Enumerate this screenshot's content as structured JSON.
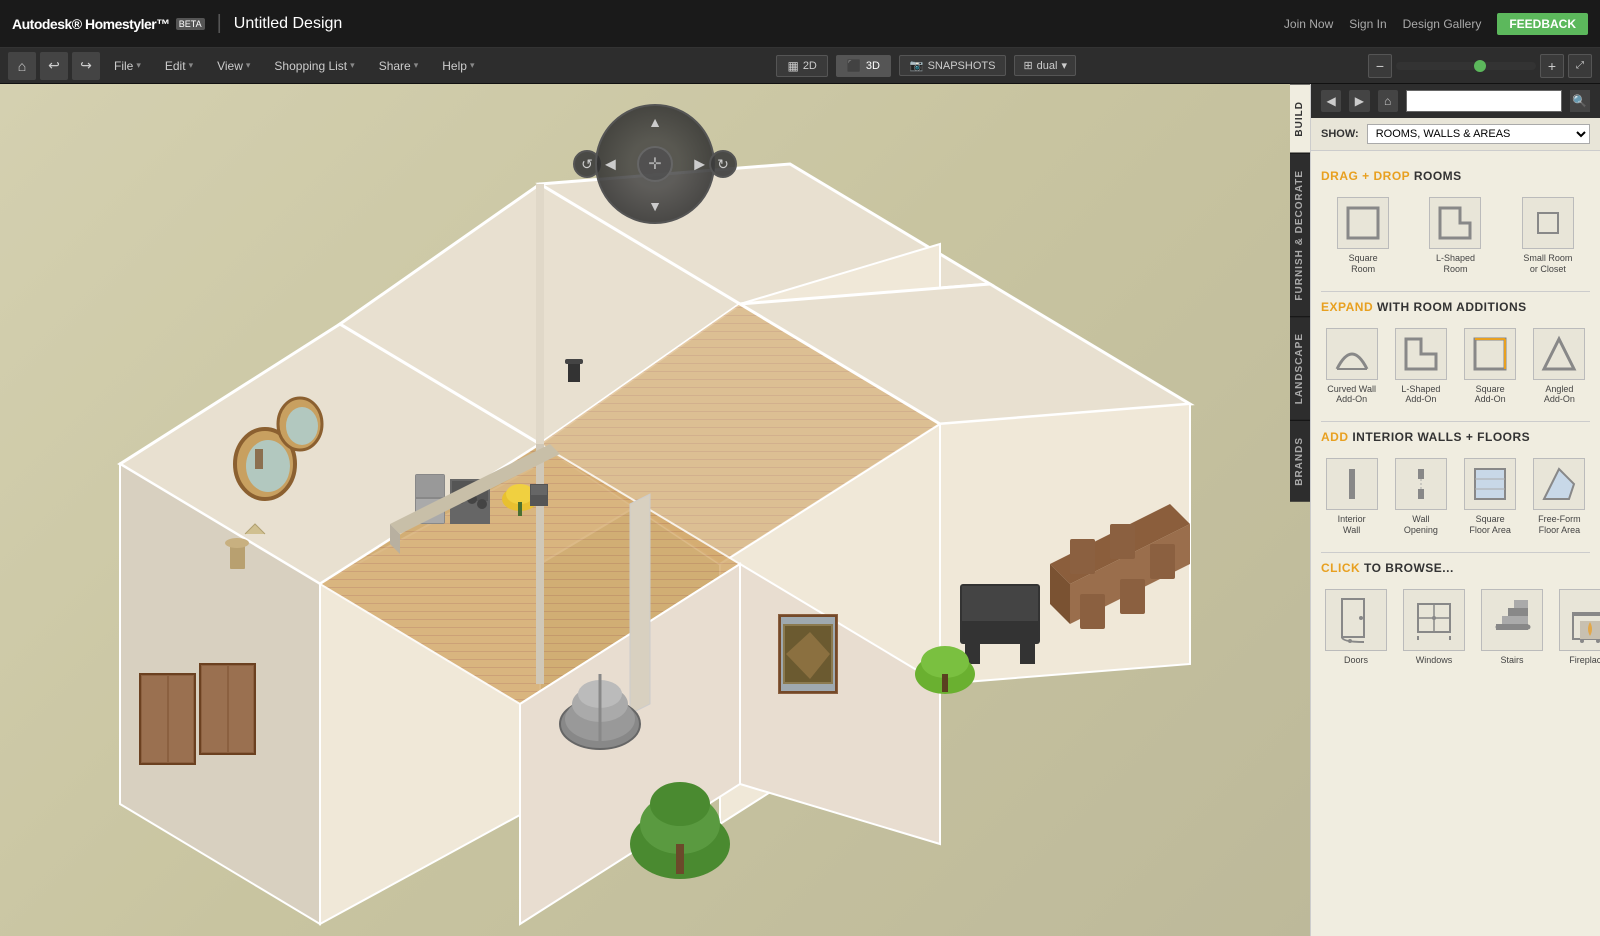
{
  "topBar": {
    "brand": "Autodesk® Homestyler™",
    "beta": "BETA",
    "titleSeparator": "|",
    "designTitle": "Untitled Design",
    "links": [
      "Join Now",
      "Sign In",
      "Design Gallery"
    ],
    "feedbackBtn": "FEEDBACK"
  },
  "menuBar": {
    "undoIcon": "↩",
    "redoIcon": "↪",
    "homeIcon": "⌂",
    "menus": [
      {
        "label": "File",
        "arrow": "▾"
      },
      {
        "label": "Edit",
        "arrow": "▾"
      },
      {
        "label": "View",
        "arrow": "▾"
      },
      {
        "label": "Shopping List",
        "arrow": "▾"
      },
      {
        "label": "Share",
        "arrow": "▾"
      },
      {
        "label": "Help",
        "arrow": "▾"
      }
    ],
    "view2D": "2D",
    "view3D": "3D",
    "snapshots": "SNAPSHOTS",
    "dual": "dual",
    "dualArrow": "▾",
    "zoomInIcon": "🔍",
    "zoomOutIcon": "🔍",
    "fullscreenIcon": "⤢"
  },
  "sideTabs": [
    {
      "label": "BUILD",
      "active": true
    },
    {
      "label": "FURNISH & DECORATE",
      "active": false
    },
    {
      "label": "LANDSCAPE",
      "active": false
    },
    {
      "label": "BRANDS",
      "active": false
    }
  ],
  "panel": {
    "backIcon": "◀",
    "forwardIcon": "▶",
    "homeIcon": "⌂",
    "searchPlaceholder": "",
    "searchIcon": "🔍",
    "showLabel": "SHOW:",
    "showOptions": [
      "ROOMS, WALLS & AREAS"
    ],
    "showSelected": "ROOMS, WALLS & AREAS",
    "sections": [
      {
        "id": "drag-rooms",
        "keyword": "DRAG + DROP",
        "rest": " ROOMS",
        "items": [
          {
            "label": "Square\nRoom",
            "iconType": "square-room"
          },
          {
            "label": "L-Shaped\nRoom",
            "iconType": "l-room"
          },
          {
            "label": "Small Room\nor Closet",
            "iconType": "small-room"
          }
        ],
        "cols": 3
      },
      {
        "id": "expand-additions",
        "keyword": "EXPAND",
        "rest": " WITH ROOM ADDITIONS",
        "items": [
          {
            "label": "Curved Wall\nAdd-On",
            "iconType": "curved-wall"
          },
          {
            "label": "L-Shaped\nAdd-On",
            "iconType": "l-addon"
          },
          {
            "label": "Square\nAdd-On",
            "iconType": "square-addon"
          },
          {
            "label": "Angled\nAdd-On",
            "iconType": "angled-addon"
          }
        ],
        "cols": 4
      },
      {
        "id": "interior-walls",
        "keyword": "ADD",
        "rest": " INTERIOR WALLS + FLOORS",
        "items": [
          {
            "label": "Interior\nWall",
            "iconType": "interior-wall"
          },
          {
            "label": "Wall\nOpening",
            "iconType": "wall-opening"
          },
          {
            "label": "Square\nFloor Area",
            "iconType": "square-floor"
          },
          {
            "label": "Free-Form\nFloor Area",
            "iconType": "freeform-floor"
          }
        ],
        "cols": 4
      },
      {
        "id": "click-browse",
        "keyword": "CLICK",
        "rest": " TO BROWSE...",
        "items": [
          {
            "label": "Doors",
            "iconType": "doors"
          },
          {
            "label": "Windows",
            "iconType": "windows"
          },
          {
            "label": "Stairs",
            "iconType": "stairs"
          },
          {
            "label": "Fireplaces",
            "iconType": "fireplaces"
          }
        ],
        "cols": 4
      }
    ]
  }
}
